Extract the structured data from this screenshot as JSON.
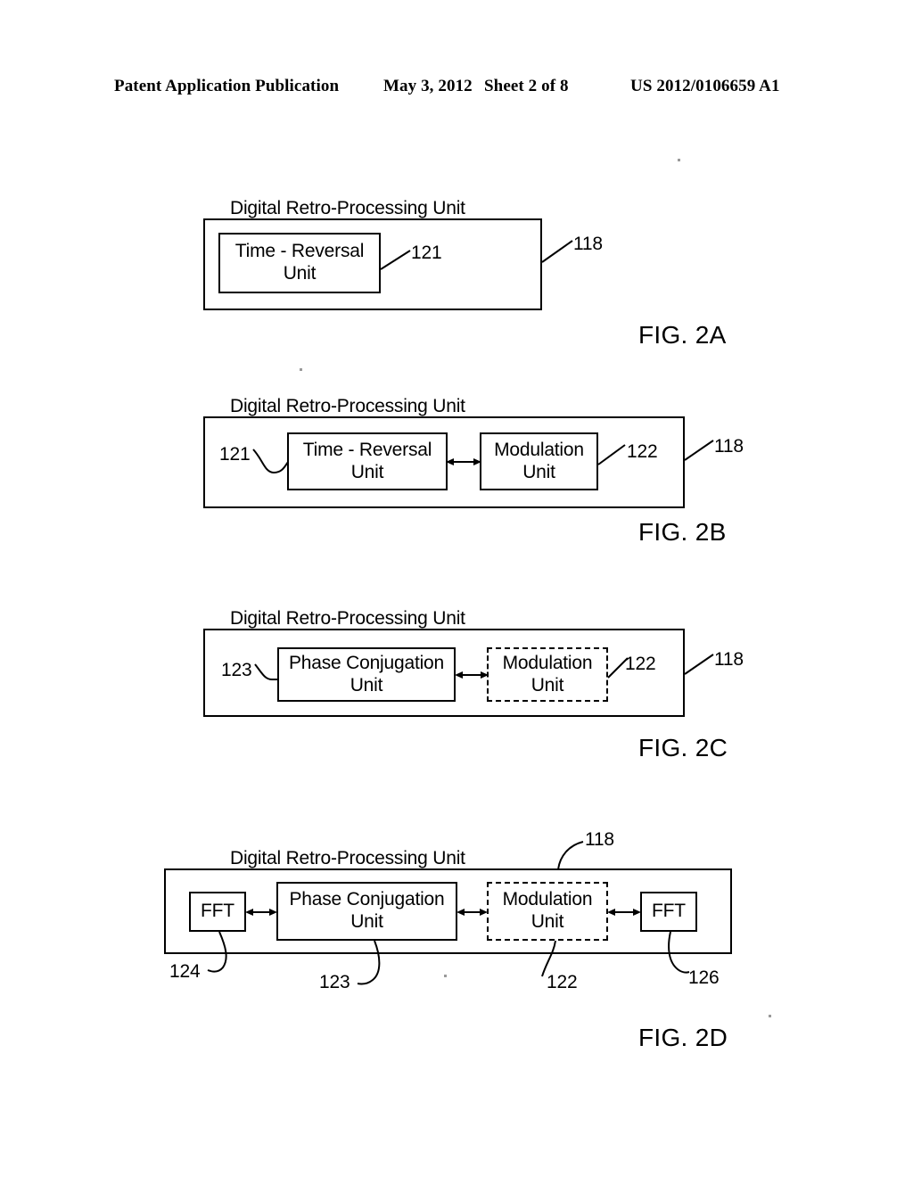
{
  "header": {
    "publication": "Patent Application Publication",
    "date": "May 3, 2012",
    "sheet": "Sheet 2 of 8",
    "number": "US 2012/0106659 A1"
  },
  "common": {
    "enclosure_label": "Digital Retro-Processing Unit",
    "outer_ref": "118"
  },
  "figures": [
    {
      "id": "2A",
      "caption": "FIG. 2A",
      "enclosure_label": "Digital Retro-Processing Unit",
      "outer_ref": "118",
      "blocks": [
        {
          "label_line1": "Time - Reversal",
          "label_line2": "Unit",
          "ref": "121",
          "style": "solid"
        }
      ],
      "connectors": []
    },
    {
      "id": "2B",
      "caption": "FIG. 2B",
      "enclosure_label": "Digital Retro-Processing Unit",
      "outer_ref": "118",
      "blocks": [
        {
          "label_line1": "Time - Reversal",
          "label_line2": "Unit",
          "ref": "121",
          "style": "solid"
        },
        {
          "label_line1": "Modulation",
          "label_line2": "Unit",
          "ref": "122",
          "style": "solid"
        }
      ],
      "connectors": [
        {
          "type": "double-arrow",
          "from": "121",
          "to": "122"
        }
      ]
    },
    {
      "id": "2C",
      "caption": "FIG. 2C",
      "enclosure_label": "Digital Retro-Processing Unit",
      "outer_ref": "118",
      "blocks": [
        {
          "label_line1": "Phase Conjugation",
          "label_line2": "Unit",
          "ref": "123",
          "style": "solid"
        },
        {
          "label_line1": "Modulation",
          "label_line2": "Unit",
          "ref": "122",
          "style": "dashed"
        }
      ],
      "connectors": [
        {
          "type": "double-arrow",
          "from": "123",
          "to": "122"
        }
      ]
    },
    {
      "id": "2D",
      "caption": "FIG. 2D",
      "enclosure_label": "Digital Retro-Processing Unit",
      "outer_ref": "118",
      "blocks": [
        {
          "label_line1": "FFT",
          "label_line2": "",
          "ref": "124",
          "style": "solid"
        },
        {
          "label_line1": "Phase Conjugation",
          "label_line2": "Unit",
          "ref": "123",
          "style": "solid"
        },
        {
          "label_line1": "Modulation",
          "label_line2": "Unit",
          "ref": "122",
          "style": "dashed"
        },
        {
          "label_line1": "FFT",
          "label_line2": "",
          "ref": "126",
          "style": "solid"
        }
      ],
      "connectors": [
        {
          "type": "double-arrow",
          "from": "124",
          "to": "123"
        },
        {
          "type": "double-arrow",
          "from": "123",
          "to": "122"
        },
        {
          "type": "double-arrow",
          "from": "122",
          "to": "126"
        }
      ]
    }
  ],
  "colors": {
    "ink": "#000000",
    "paper": "#ffffff"
  }
}
